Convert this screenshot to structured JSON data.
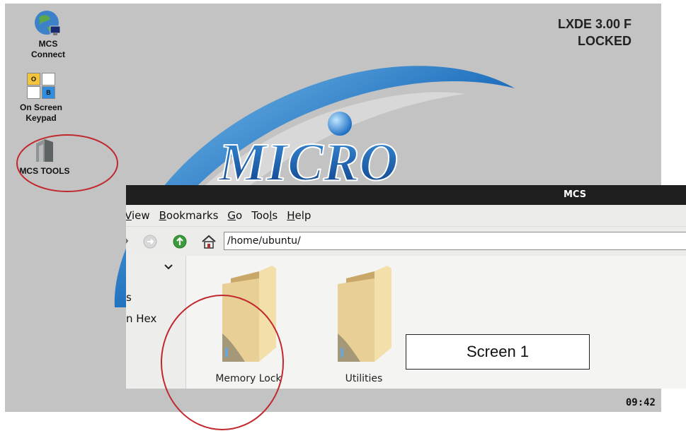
{
  "desktop": {
    "icons": [
      {
        "label_line1": "MCS",
        "label_line2": "Connect"
      },
      {
        "label_line1": "On Screen",
        "label_line2": "Keypad",
        "keys": [
          "O",
          "",
          "",
          "B"
        ]
      },
      {
        "label": "MCS TOOLS"
      }
    ],
    "version_line1": "LXDE 3.00 F",
    "version_line2": "LOCKED",
    "logo_text": "MICRO",
    "clock": "09:42"
  },
  "window": {
    "title": "MCS",
    "menu": [
      "View",
      "Bookmarks",
      "Go",
      "Tools",
      "Help"
    ],
    "path": "/home/ubuntu/",
    "sidebar_items": [
      "s",
      "n Hex"
    ],
    "folders": [
      {
        "label": "Memory Lock"
      },
      {
        "label": "Utilities"
      }
    ]
  },
  "annotation": {
    "screen_label": "Screen 1",
    "highlight_color": "#c0282d"
  }
}
